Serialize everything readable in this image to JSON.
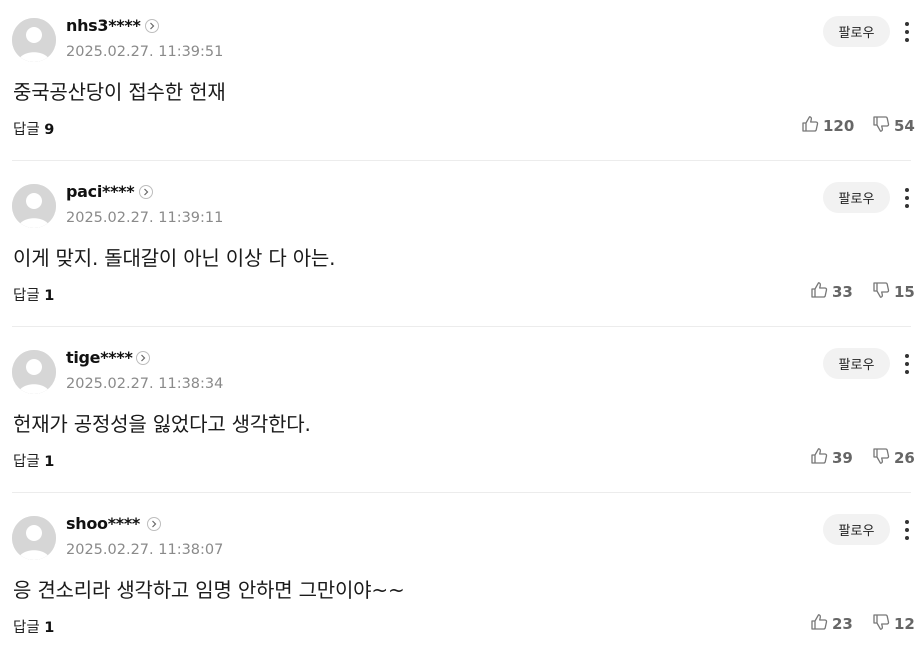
{
  "labels": {
    "follow": "팔로우",
    "reply": "답글"
  },
  "comments": [
    {
      "username": "nhs3****",
      "timestamp": "2025.02.27. 11:39:51",
      "text": "중국공산당이 접수한 헌재",
      "reply_count": "9",
      "likes": "120",
      "dislikes": "54"
    },
    {
      "username": "paci****",
      "timestamp": "2025.02.27. 11:39:11",
      "text": "이게 맞지. 돌대갈이 아닌 이상 다 아는.",
      "reply_count": "1",
      "likes": "33",
      "dislikes": "15"
    },
    {
      "username": "tige****",
      "timestamp": "2025.02.27. 11:38:34",
      "text": "헌재가 공정성을 잃었다고 생각한다.",
      "reply_count": "1",
      "likes": "39",
      "dislikes": "26"
    },
    {
      "username": "shoo****",
      "timestamp": "2025.02.27. 11:38:07",
      "text": "응 견소리라 생각하고 임명 안하면 그만이야~~",
      "reply_count": "1",
      "likes": "23",
      "dislikes": "12"
    }
  ],
  "icons": {
    "avatar": "default-avatar-icon",
    "profile": "chevron-right-icon",
    "more": "more-vertical-icon",
    "like": "thumbs-up-icon",
    "dislike": "thumbs-down-icon"
  },
  "colors": {
    "avatar_bg": "#d9d9d9",
    "follow_bg": "#f2f2f2",
    "timestamp": "#8a8a8a",
    "vote": "#666666"
  }
}
